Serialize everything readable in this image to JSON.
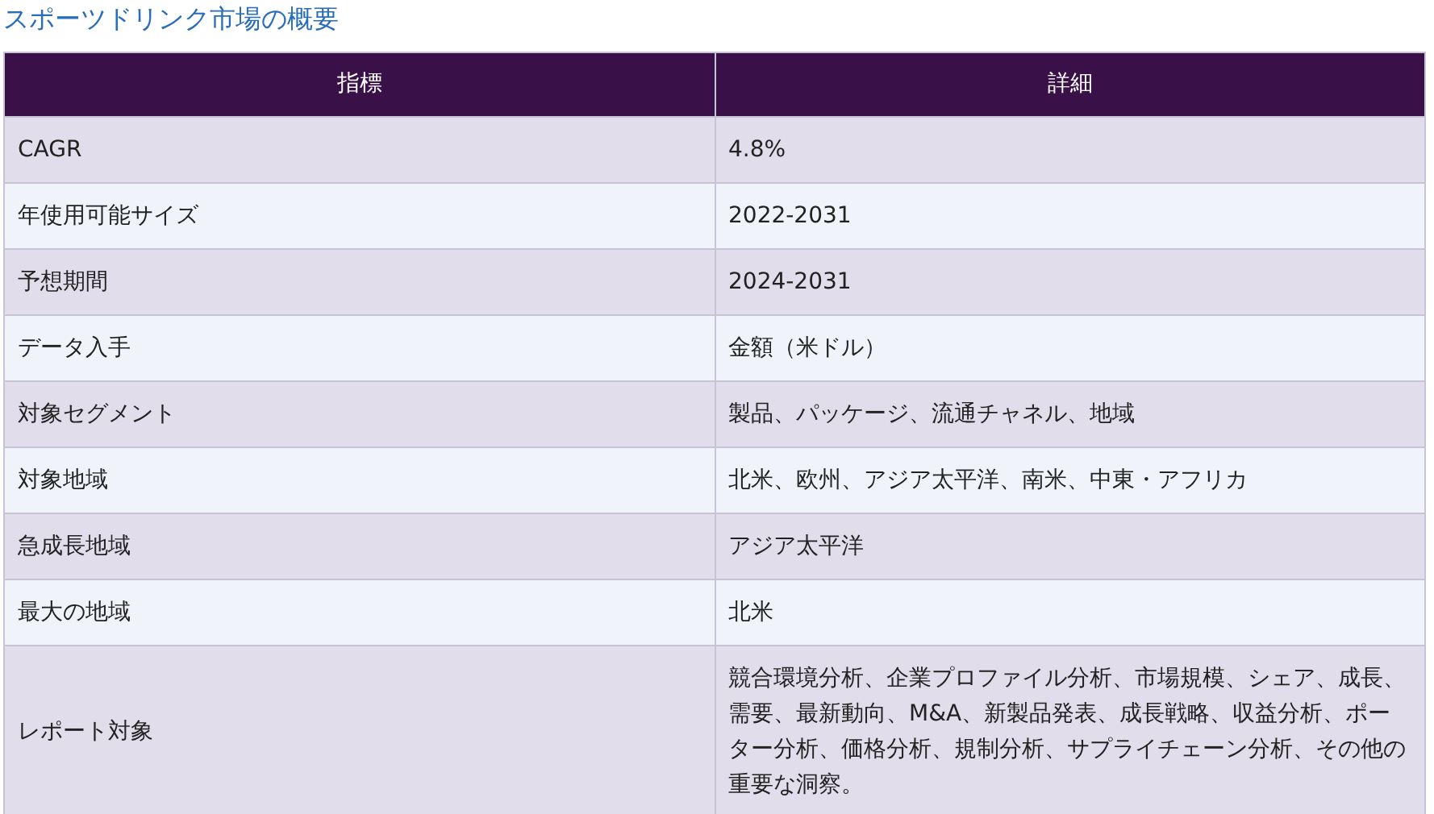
{
  "title": "スポーツドリンク市場の概要",
  "table": {
    "columns": [
      "指標",
      "詳細"
    ],
    "rows": [
      [
        "CAGR",
        "4.8%"
      ],
      [
        "年使用可能サイズ",
        "2022-2031"
      ],
      [
        "予想期間",
        "2024-2031"
      ],
      [
        "データ入手",
        "金額（米ドル）"
      ],
      [
        "対象セグメント",
        "製品、パッケージ、流通チャネル、地域"
      ],
      [
        "対象地域",
        "北米、欧州、アジア太平洋、南米、中東・アフリカ"
      ],
      [
        "急成長地域",
        "アジア太平洋"
      ],
      [
        "最大の地域",
        "北米"
      ],
      [
        "レポート対象",
        "競合環境分析、企業プロファイル分析、市場規模、シェア、成長、需要、最新動向、M&A、新製品発表、成長戦略、収益分析、ポーター分析、価格分析、規制分析、サプライチェーン分析、その他の重要な洞察。"
      ]
    ]
  }
}
